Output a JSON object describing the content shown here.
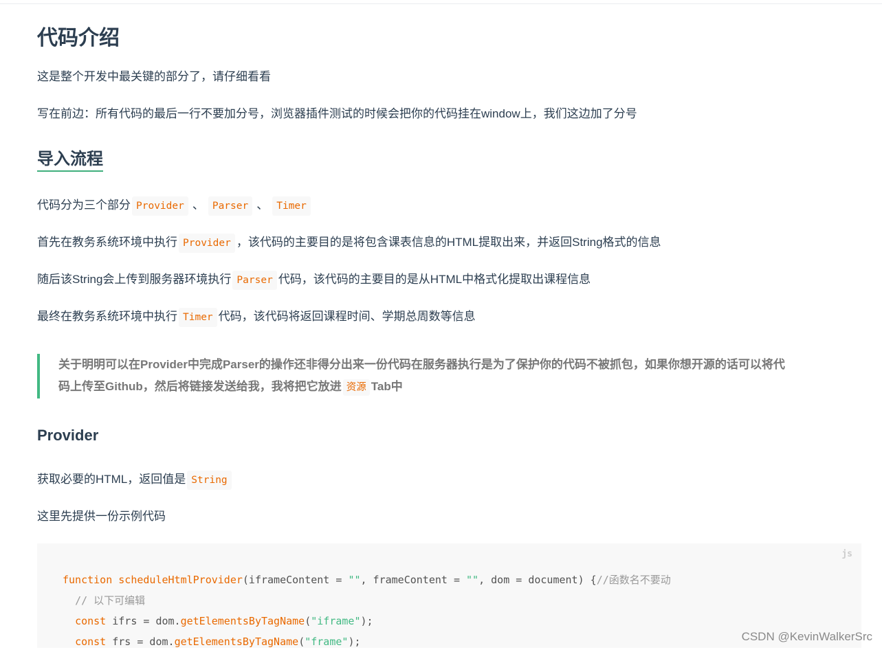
{
  "title": "代码介绍",
  "intro": "这是整个开发中最关键的部分了，请仔细看看",
  "note": "写在前边：所有代码的最后一行不要加分号，浏览器插件测试的时候会把你的代码挂在window上，我们这边加了分号",
  "import_section": {
    "heading": "导入流程",
    "parts_prefix": "代码分为三个部分",
    "sep": "、",
    "parts": [
      "Provider",
      "Parser",
      "Timer"
    ],
    "step1_prefix": "首先在教务系统环境中执行",
    "step1_code": "Provider",
    "step1_suffix": "，该代码的主要目的是将包含课表信息的HTML提取出来，并返回String格式的信息",
    "step2_prefix": "随后该String会上传到服务器环境执行",
    "step2_code": "Parser",
    "step2_suffix": "代码，该代码的主要目的是从HTML中格式化提取出课程信息",
    "step3_prefix": "最终在教务系统环境中执行",
    "step3_code": "Timer",
    "step3_suffix": "代码，该代码将返回课程时间、学期总周数等信息"
  },
  "quote": {
    "line1": "关于明明可以在Provider中完成Parser的操作还非得分出来一份代码在服务器执行是为了保护你的代码不被抓包，如果你想开源的话可以将代",
    "line2_prefix": "码上传至Github，然后将链接发送给我，我将把它放进",
    "line2_code": "资源",
    "line2_suffix": "Tab中"
  },
  "provider_section": {
    "heading": "Provider",
    "desc_prefix": "获取必要的HTML，返回值是",
    "desc_code": "String",
    "sample_intro": "这里先提供一份示例代码"
  },
  "code": {
    "lang": "js",
    "line1": {
      "kw": "function",
      "fn": "scheduleHtmlProvider",
      "a": "(iframeContent = ",
      "s1": "\"\"",
      "b": ", frameContent = ",
      "s2": "\"\"",
      "c": ", dom = document) {",
      "cmt": "//函数名不要动"
    },
    "line2": "// 以下可编辑",
    "line3": {
      "kw": "const",
      "a": " ifrs = dom.",
      "fn": "getElementsByTagName",
      "b": "(",
      "s": "\"iframe\"",
      "c": ");"
    },
    "line4": {
      "kw": "const",
      "a": " frs = dom.",
      "fn": "getElementsByTagName",
      "b": "(",
      "s": "\"frame\"",
      "c": ");"
    }
  },
  "watermark": "CSDN @KevinWalkerSrc"
}
